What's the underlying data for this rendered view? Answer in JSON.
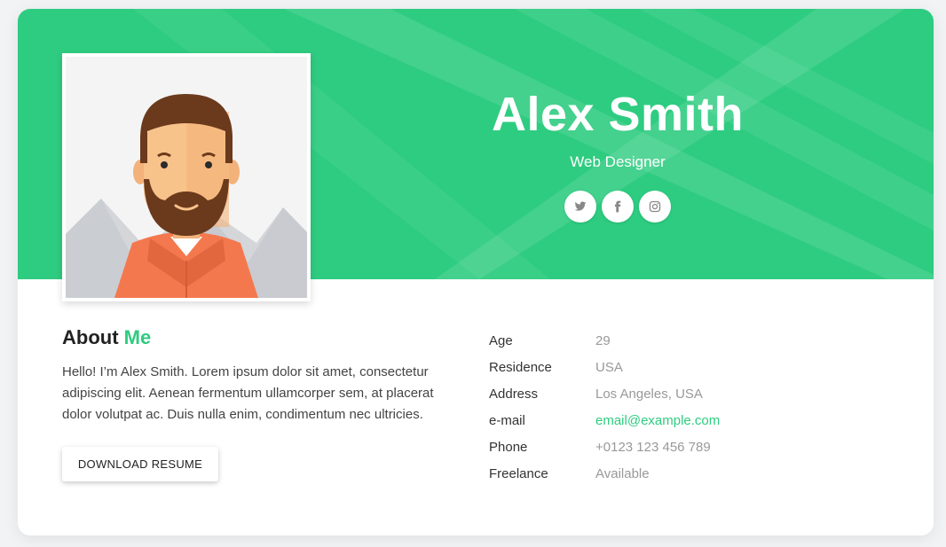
{
  "profile": {
    "name": "Alex Smith",
    "role": "Web Designer"
  },
  "socials": [
    {
      "icon": "twitter-icon"
    },
    {
      "icon": "facebook-icon"
    },
    {
      "icon": "instagram-icon"
    }
  ],
  "about": {
    "title_main": "About",
    "title_accent": "Me",
    "text": "Hello! I’m Alex Smith. Lorem ipsum dolor sit amet, consectetur adipiscing elit. Aenean fermentum ullamcorper sem, at placerat dolor volutpat ac. Duis nulla enim, condimentum nec ultricies.",
    "button_label": "DOWNLOAD RESUME"
  },
  "info": [
    {
      "label": "Age",
      "value": "29"
    },
    {
      "label": "Residence",
      "value": "USA"
    },
    {
      "label": "Address",
      "value": "Los Angeles, USA"
    },
    {
      "label": "e-mail",
      "value": "email@example.com"
    },
    {
      "label": "Phone",
      "value": "+0123 123 456 789"
    },
    {
      "label": "Freelance",
      "value": "Available"
    }
  ],
  "colors": {
    "accent": "#2ecc80",
    "label": "#333333",
    "value": "#999999"
  }
}
